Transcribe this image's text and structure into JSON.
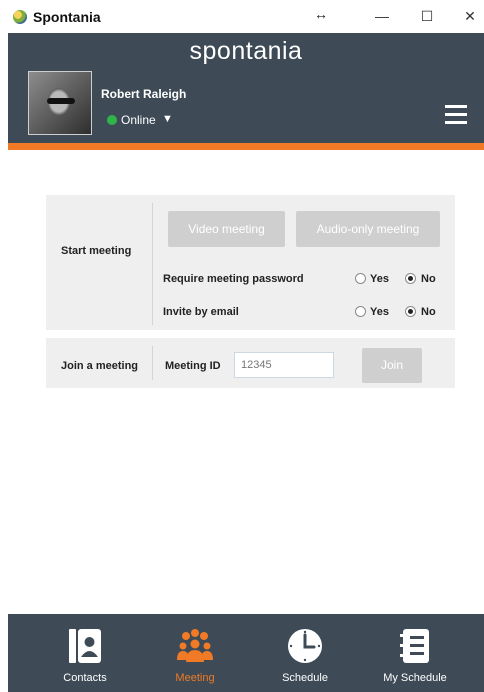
{
  "window": {
    "title": "Spontania",
    "resize_icon": "↔",
    "minimize": "—",
    "maximize": "☐",
    "close": "✕"
  },
  "header": {
    "logo": "spontania",
    "user_name": "Robert Raleigh",
    "status": "Online",
    "status_color": "#2fb44a",
    "status_caret": "▼",
    "accent_color": "#f07a25",
    "bg_color": "#3e4b56"
  },
  "start_meeting": {
    "label": "Start meeting",
    "video_button": "Video meeting",
    "audio_button": "Audio-only meeting",
    "require_password": {
      "label": "Require meeting password",
      "options": [
        "Yes",
        "No"
      ],
      "selected": "No"
    },
    "invite_email": {
      "label": "Invite by email",
      "options": [
        "Yes",
        "No"
      ],
      "selected": "No"
    }
  },
  "join_meeting": {
    "label": "Join a meeting",
    "meeting_id_label": "Meeting ID",
    "meeting_id_placeholder": "12345",
    "join_button": "Join"
  },
  "bottom_nav": {
    "items": [
      {
        "label": "Contacts",
        "icon": "contacts-icon",
        "active": false
      },
      {
        "label": "Meeting",
        "icon": "meeting-icon",
        "active": true
      },
      {
        "label": "Schedule",
        "icon": "clock-icon",
        "active": false
      },
      {
        "label": "My Schedule",
        "icon": "my-schedule-icon",
        "active": false
      }
    ]
  }
}
